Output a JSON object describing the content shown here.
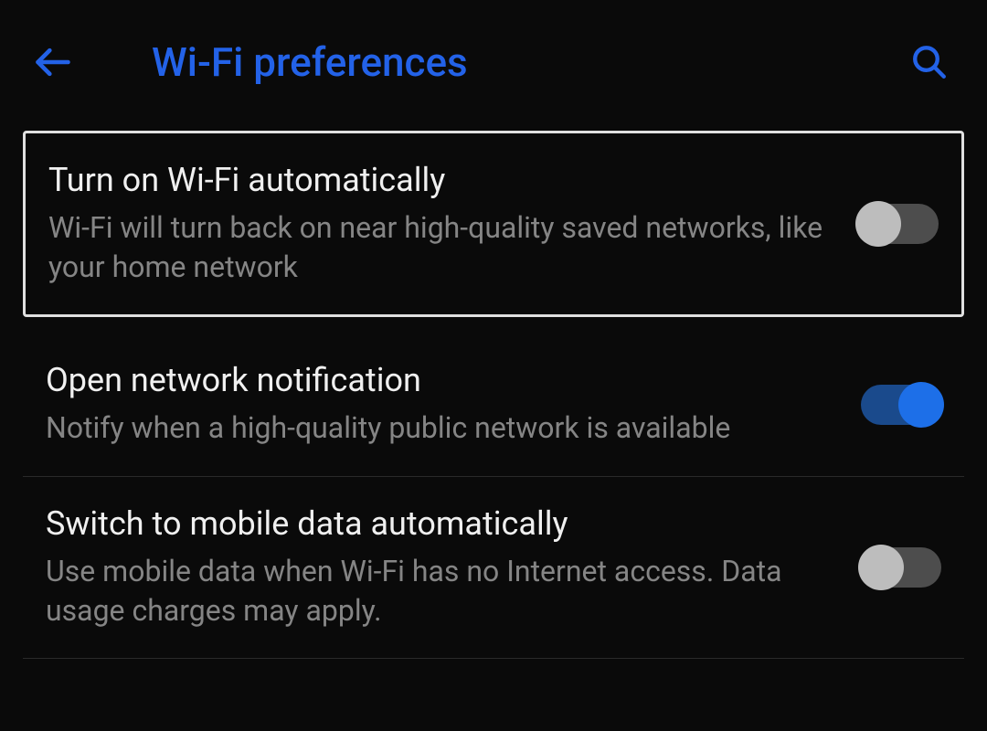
{
  "header": {
    "title": "Wi-Fi preferences"
  },
  "settings": [
    {
      "title": "Turn on Wi-Fi automatically",
      "description": "Wi-Fi will turn back on near high-quality saved networks, like your home network",
      "enabled": false,
      "highlighted": true
    },
    {
      "title": "Open network notification",
      "description": "Notify when a high-quality public network is available",
      "enabled": true,
      "highlighted": false
    },
    {
      "title": "Switch to mobile data automatically",
      "description": "Use mobile data when Wi-Fi has no Internet access. Data usage charges may apply.",
      "enabled": false,
      "highlighted": false
    }
  ]
}
